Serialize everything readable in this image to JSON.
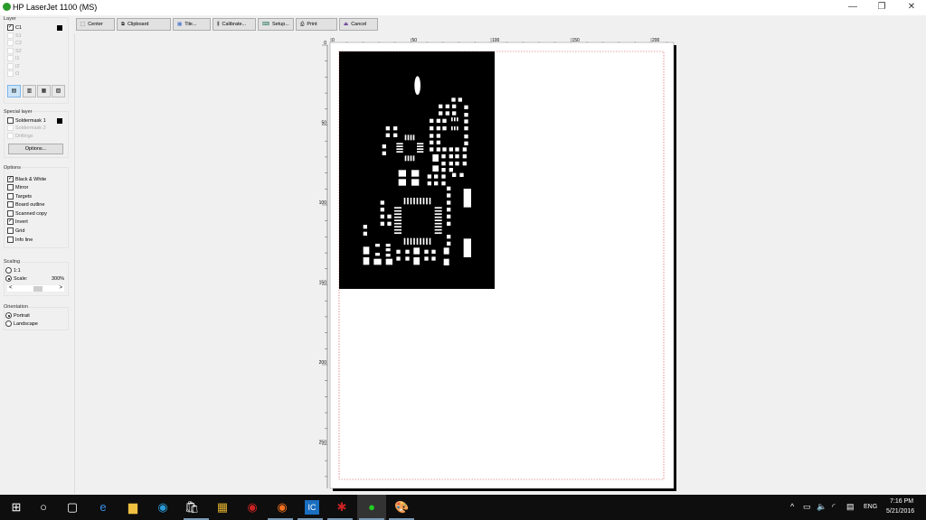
{
  "window": {
    "title": "HP LaserJet 1100 (MS)",
    "minimize": "—",
    "restore": "❐",
    "close": "✕",
    "help": "?"
  },
  "toolbar": {
    "center": "Center",
    "clipboard": "Clipboard",
    "tile": "Tile...",
    "calibrate": "Calibrate...",
    "setup": "Setup...",
    "print": "Print",
    "cancel": "Cancel"
  },
  "layer": {
    "title": "Layer",
    "items": [
      {
        "label": "C1",
        "checked": true
      },
      {
        "label": "S1"
      },
      {
        "label": "C2"
      },
      {
        "label": "S2"
      },
      {
        "label": "I1"
      },
      {
        "label": "I2"
      },
      {
        "label": "O"
      }
    ]
  },
  "special": {
    "title": "Special layer",
    "items": [
      {
        "label": "Soldermask 1"
      },
      {
        "label": "Soldermask 2"
      },
      {
        "label": "Drillings"
      }
    ],
    "options_button": "Options..."
  },
  "options": {
    "title": "Options",
    "items": [
      {
        "label": "Black & White",
        "checked": true
      },
      {
        "label": "Mirror"
      },
      {
        "label": "Targets"
      },
      {
        "label": "Board outline"
      },
      {
        "label": "Scanned copy"
      },
      {
        "label": "Invert",
        "checked": true
      },
      {
        "label": "Grid"
      },
      {
        "label": "Info line"
      }
    ]
  },
  "scaling": {
    "title": "Scaling",
    "one": "1:1",
    "scale": "Scale:",
    "value": "300%",
    "left": "<",
    "right": ">"
  },
  "orientation": {
    "title": "Orientation",
    "portrait": "Portrait",
    "landscape": "Landscape"
  },
  "ruler": {
    "top": [
      "0",
      "50",
      "100",
      "150",
      "200"
    ],
    "left": [
      "0",
      "50",
      "100",
      "150",
      "200",
      "250"
    ]
  },
  "taskbar": {
    "time": "7:16 PM",
    "date": "5/21/2016",
    "lang": "ENG"
  }
}
